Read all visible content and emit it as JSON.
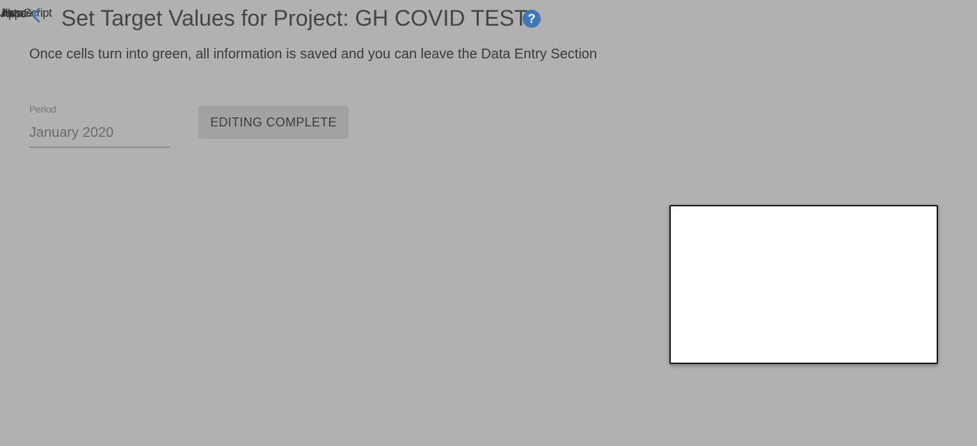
{
  "overlap_labels": [
    "JavaScript",
    "Apps",
    "Home",
    "data"
  ],
  "header": {
    "title": "Set Target Values for Project: GH COVID TEST",
    "back_icon": "arrow-left-icon",
    "help_icon": "question-circle-icon"
  },
  "info": {
    "message": "Once cells turn into green, all information is saved and you can leave the Data Entry Section"
  },
  "period": {
    "label": "Period",
    "value": "January 2020"
  },
  "actions": {
    "editing_complete_label": "EDITING COMPLETE"
  },
  "colors": {
    "background": "#b1b1b1",
    "accent": "#3f78b5",
    "dialog": "#ffffff"
  }
}
